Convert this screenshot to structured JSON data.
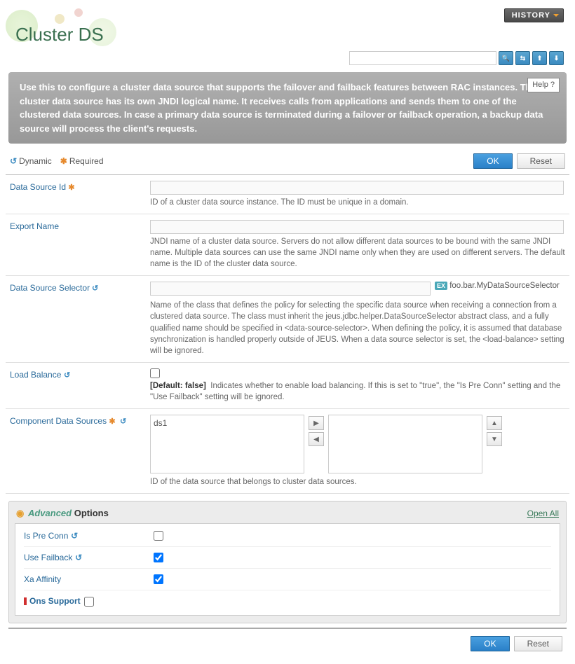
{
  "header": {
    "history_label": "HISTORY",
    "title": "Cluster DS",
    "help_label": "Help ?"
  },
  "intro": "Use this to configure a cluster data source that supports the failover and failback features between RAC instances. The cluster data source has its own JNDI logical name. It receives calls from applications and sends them to one of the clustered data sources. In case a primary data source is terminated during a failover or failback operation, a backup data source will process the client's requests.",
  "legend": {
    "dynamic": "Dynamic",
    "required": "Required"
  },
  "actions": {
    "ok": "OK",
    "reset": "Reset"
  },
  "fields": {
    "data_source_id": {
      "label": "Data Source Id",
      "help": "ID of a cluster data source instance. The ID must be unique in a domain."
    },
    "export_name": {
      "label": "Export Name",
      "help": "JNDI name of a cluster data source. Servers do not allow different data sources to be bound with the same JNDI name. Multiple data sources can use the same JNDI name only when they are used on different servers. The default name is the ID of the cluster data source."
    },
    "data_source_selector": {
      "label": "Data Source Selector",
      "example": "foo.bar.MyDataSourceSelector",
      "help": "Name of the class that defines the policy for selecting the specific data source when receiving a connection from a clustered data source. The class must inherit the jeus.jdbc.helper.DataSourceSelector abstract class, and a fully qualified name should be specified in <data-source-selector>. When defining the policy, it is assumed that database synchronization is handled properly outside of JEUS. When a data source selector is set, the <load-balance> setting will be ignored."
    },
    "load_balance": {
      "label": "Load Balance",
      "default": "[Default: false]",
      "help": "Indicates whether to enable load balancing. If this is set to \"true\", the \"Is Pre Conn\" setting and the \"Use Failback\" setting will be ignored."
    },
    "component_ds": {
      "label": "Component Data Sources",
      "available": [
        "ds1"
      ],
      "help": "ID of the data source that belongs to cluster data sources."
    }
  },
  "advanced": {
    "title_em": "Advanced",
    "title_rest": "Options",
    "open_all": "Open All",
    "is_pre_conn": {
      "label": "Is Pre Conn",
      "checked": false
    },
    "use_failback": {
      "label": "Use Failback",
      "checked": true
    },
    "xa_affinity": {
      "label": "Xa Affinity",
      "checked": true
    },
    "ons_support": {
      "label": "Ons Support",
      "checked": false
    }
  }
}
